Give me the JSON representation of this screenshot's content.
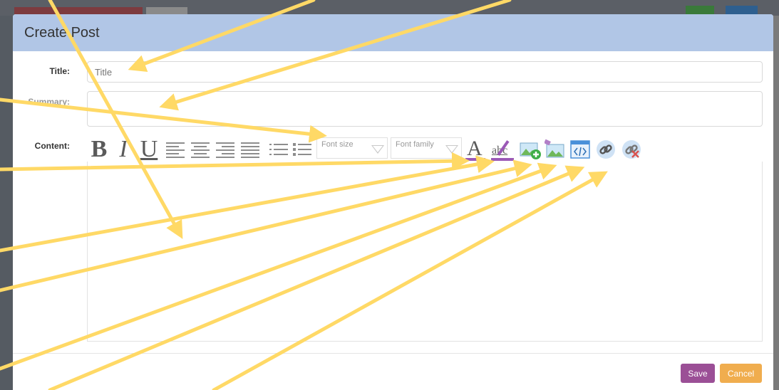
{
  "modal": {
    "title": "Create Post"
  },
  "form": {
    "title_label": "Title:",
    "title_placeholder": "Title",
    "summary_label": "Summary:",
    "content_label": "Content:"
  },
  "toolbar": {
    "bold": "B",
    "italic": "I",
    "underline": "U",
    "font_size_placeholder": "Font size",
    "font_family_placeholder": "Font family",
    "font_color": "A",
    "spell_check": "abc",
    "icons": [
      "bold-icon",
      "italic-icon",
      "underline-icon",
      "align-left-icon",
      "align-center-icon",
      "align-right-icon",
      "align-justify-icon",
      "ordered-list-icon",
      "unordered-list-icon",
      "font-color-icon",
      "spell-check-icon",
      "insert-image-icon",
      "edit-image-icon",
      "html-source-icon",
      "link-icon",
      "unlink-icon"
    ]
  },
  "footer": {
    "save_label": "Save",
    "cancel_label": "Cancel"
  },
  "colors": {
    "header": "#b1c6e6",
    "save": "#9b4f96",
    "cancel": "#f0ad4e",
    "annotation_arrow": "#ffd966"
  }
}
